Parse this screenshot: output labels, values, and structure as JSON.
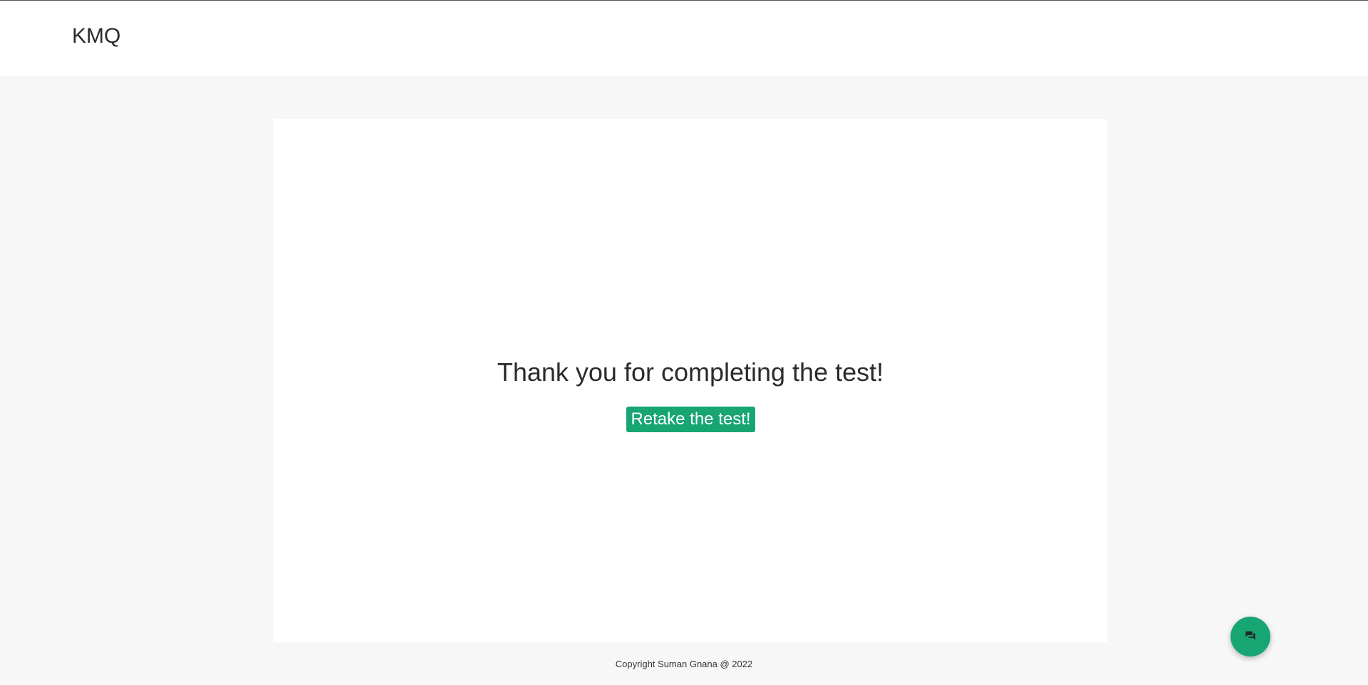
{
  "header": {
    "brand": "KMQ"
  },
  "main": {
    "message": "Thank you for completing the test!",
    "retake_label": "Retake the test!"
  },
  "footer": {
    "copyright": "Copyright Suman Gnana @ 2022"
  },
  "chat": {
    "icon": "chat-bubbles-icon"
  },
  "colors": {
    "accent": "#17a673",
    "page_bg": "#f7f7f7",
    "card_bg": "#ffffff",
    "text": "#2b2b2b"
  }
}
